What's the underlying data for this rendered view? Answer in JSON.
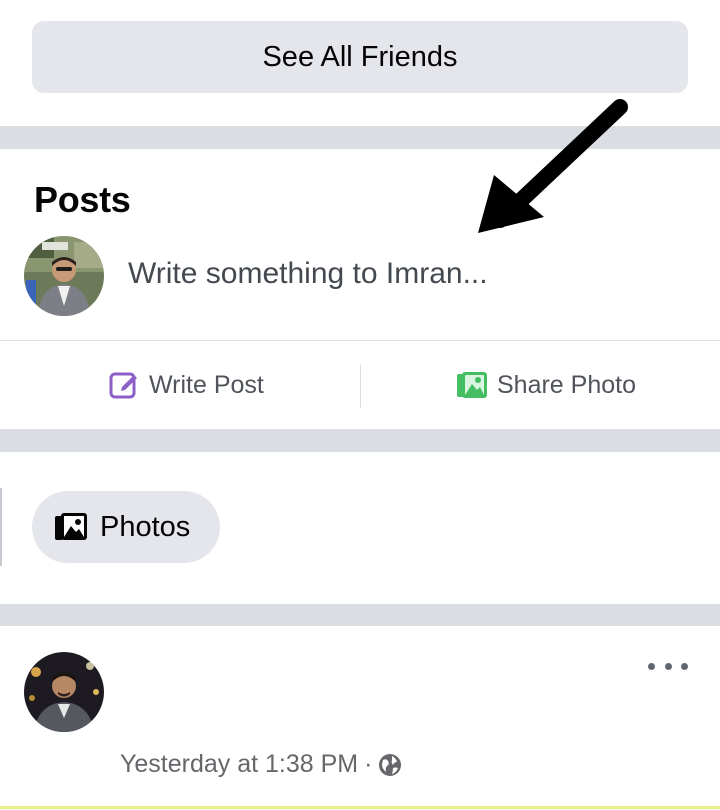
{
  "friends": {
    "see_all_label": "See All Friends"
  },
  "posts": {
    "title": "Posts",
    "composer_placeholder": "Write something to Imran...",
    "write_post_label": "Write Post",
    "share_photo_label": "Share Photo"
  },
  "photos_chip": {
    "label": "Photos"
  },
  "post": {
    "timestamp": "Yesterday at 1:38 PM",
    "separator": "·",
    "audience_icon": "globe-icon",
    "more_icon": "more-options-icon"
  },
  "colors": {
    "button_bg": "#e4e6eb",
    "separator_bg": "#dadde1",
    "write_post_icon": "#8b5fc7",
    "share_photo_icon": "#45bd62",
    "secondary_text": "#65676b"
  }
}
